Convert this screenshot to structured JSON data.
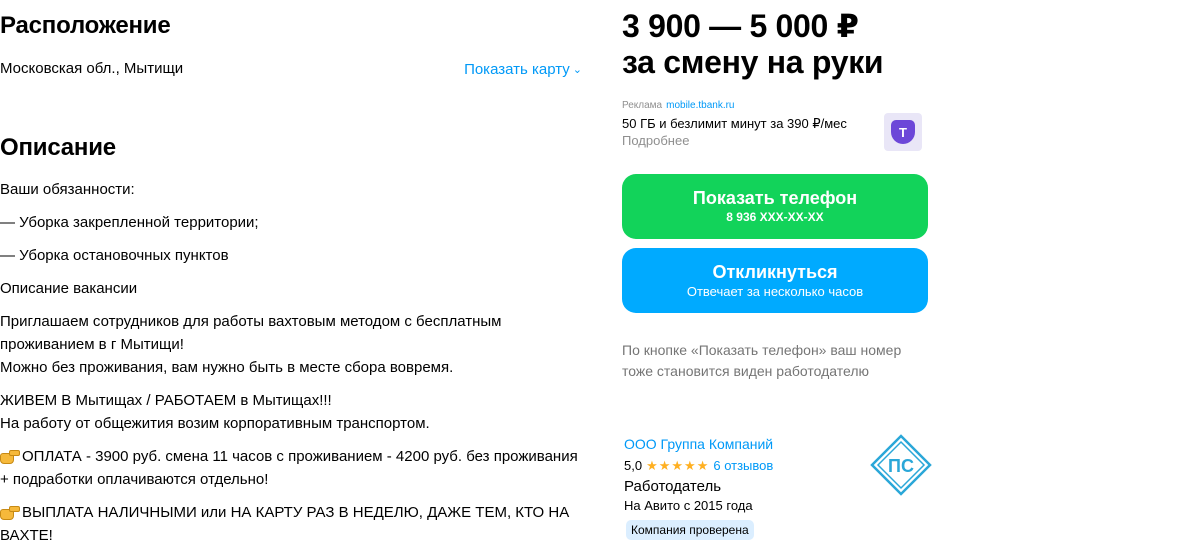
{
  "location": {
    "heading": "Расположение",
    "address": "Московская обл., Мытищи",
    "show_map_label": "Показать карту"
  },
  "description": {
    "heading": "Описание",
    "lines": [
      "Ваши обязанности:",
      "— Уборка закрепленной территории;",
      "— Уборка остановочных пунктов",
      "Описание вакансии",
      "Приглашаем сотрудников для работы вахтовым методом с бесплатным проживанием в г Мытищи!",
      "Можно без проживания, вам нужно быть в месте сбора вовремя.",
      "ЖИВЕМ В Мытищах / РАБОТАЕМ в Мытищах!!!",
      "На работу от общежития возим корпоративным транспортом.",
      "ОПЛАТА - 3900 руб. смена 11 часов с проживанием - 4200 руб. без проживания + подработки оплачиваются отдельно!",
      "ВЫПЛАТА НАЛИЧНЫМИ или НА КАРТУ РАЗ В НЕДЕЛЮ, ДАЖЕ ТЕМ, КТО НА ВАХТЕ!"
    ]
  },
  "salary": {
    "range": "3 900 — 5 000 ₽",
    "period": "за смену на руки"
  },
  "ad": {
    "label": "Реклама",
    "domain": "mobile.tbank.ru",
    "text": "50 ГБ и безлимит минут за 390 ₽/мес",
    "more": "Подробнее",
    "logo_letter": "T"
  },
  "buttons": {
    "phone_label": "Показать телефон",
    "phone_number": "8 936 XXX-XX-XX",
    "reply_label": "Откликнуться",
    "reply_sub": "Отвечает за несколько часов"
  },
  "note": "По кнопке «Показать телефон» ваш номер тоже становится виден работодателю",
  "employer": {
    "name": "ООО Группа Компаний",
    "rating": "5,0",
    "stars": "★★★★★",
    "reviews": "6 отзывов",
    "role": "Работодатель",
    "since": "На Авито с 2015 года",
    "verified": "Компания проверена",
    "logo_text": "ПС"
  },
  "colors": {
    "link": "#0099f7",
    "phone_button": "#12d35a",
    "reply_button": "#00aaff",
    "stars": "#ffb021",
    "verified_bg": "#dbeeff"
  },
  "icons": [
    "chevron-down-icon",
    "pointing-hand-icon",
    "tbank-logo-icon",
    "company-logo-icon",
    "star-icon"
  ]
}
